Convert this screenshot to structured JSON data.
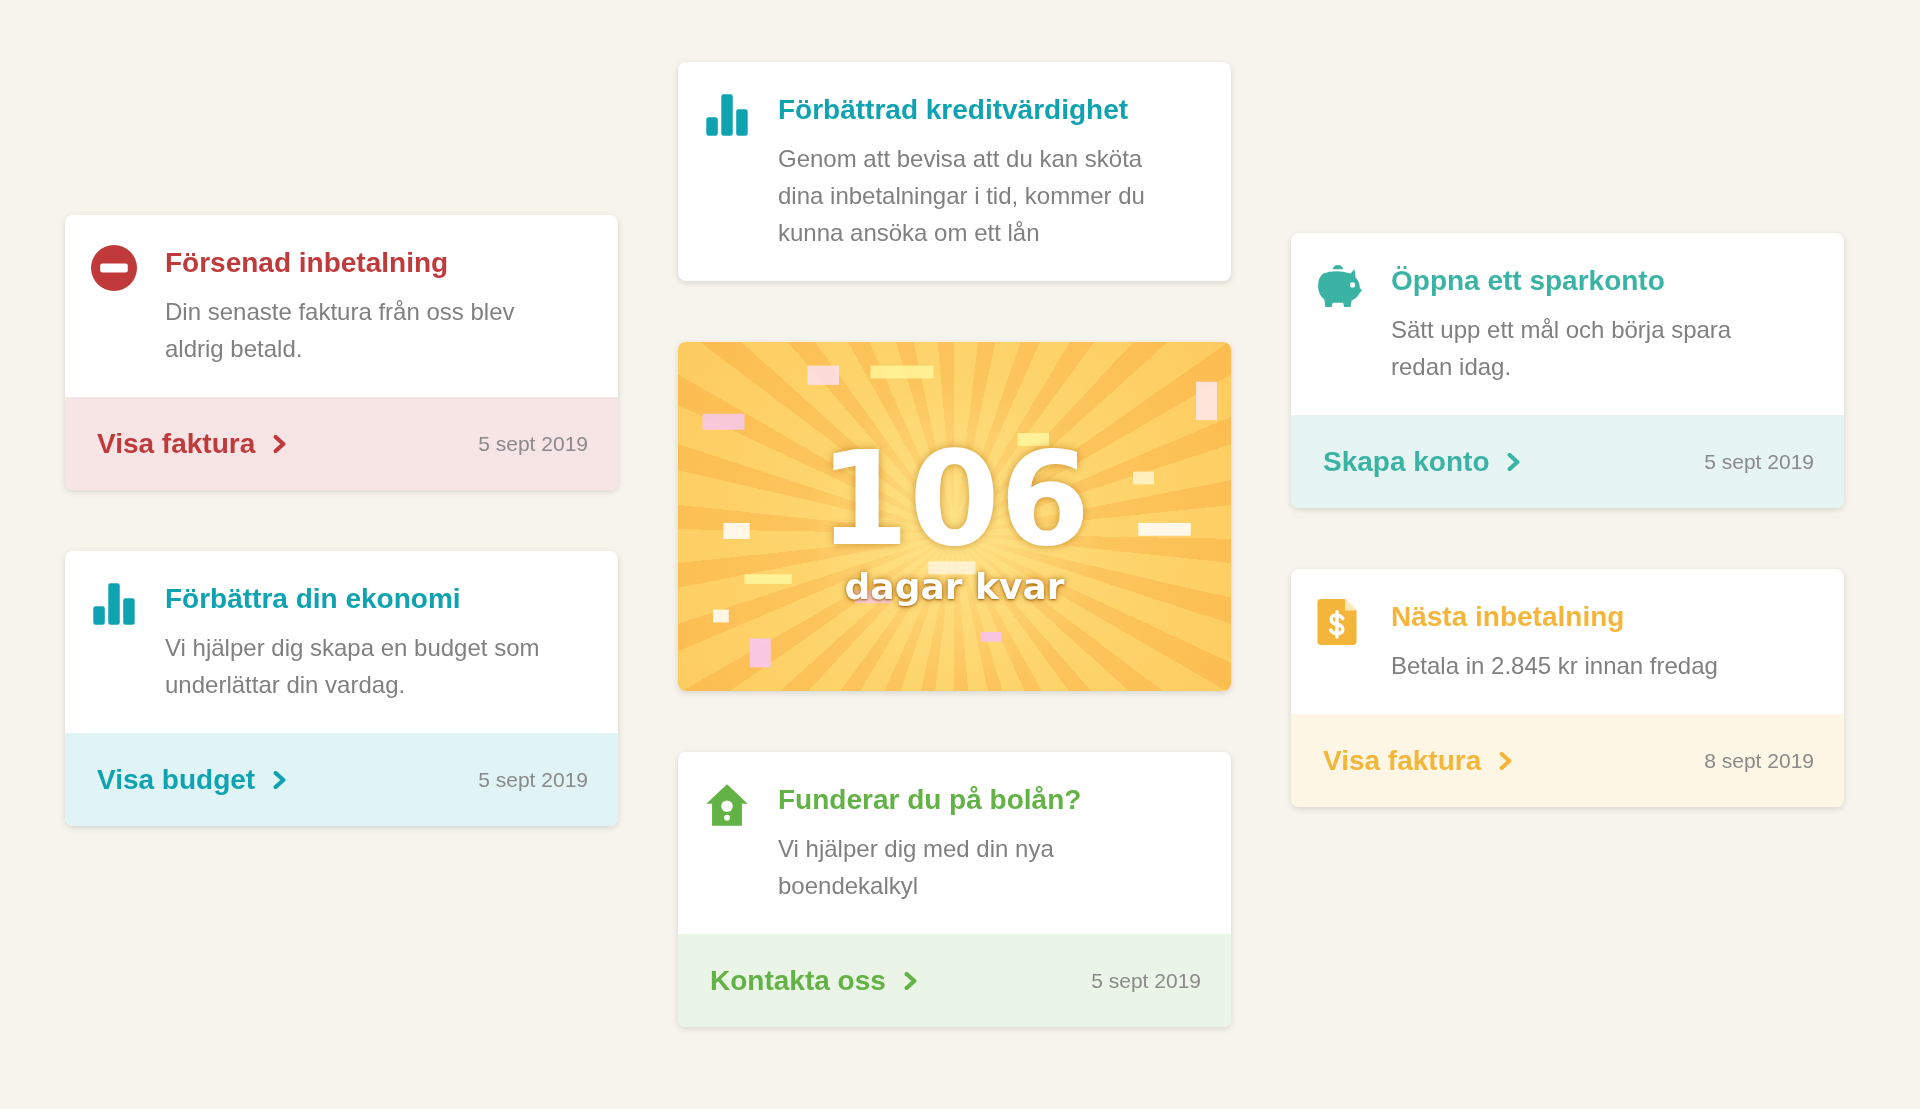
{
  "columns": [
    {
      "cards": [
        {
          "kind": "overdue",
          "color": "#c0393b",
          "title": "Försenad inbetalning",
          "text": "Din senaste faktura från oss blev aldrig betald.",
          "link": "Visa faktura",
          "date": "5 sept 2019"
        },
        {
          "kind": "insight",
          "color": "#0fa3b1",
          "title": "Förbättra din ekonomi",
          "text": "Vi hjälper dig skapa en budget som underlättar din vardag.",
          "link": "Visa budget",
          "date": "5 sept 2019"
        }
      ]
    },
    {
      "cards": [
        {
          "kind": "insight",
          "color": "#0fa3b1",
          "title": "Förbättrad kreditvärdighet",
          "text": "Genom att bevisa att du kan sköta dina inbetalningar i tid, kommer du kunna ansöka om ett lån"
        },
        {
          "kind": "countdown",
          "number": "106",
          "caption": "dagar kvar"
        },
        {
          "kind": "mortgage",
          "color": "#62b246",
          "title": "Funderar du på bolån?",
          "text": "Vi hjälper dig med din nya boendekalkyl",
          "link": "Kontakta oss",
          "date": "5 sept 2019"
        }
      ]
    },
    {
      "cards": [
        {
          "kind": "savings",
          "color": "#3bb3a4",
          "title": "Öppna ett sparkonto",
          "text": "Sätt upp ett mål och börja spara redan idag.",
          "link": "Skapa konto",
          "date": "5 sept 2019"
        },
        {
          "kind": "payment",
          "color": "#f4b63a",
          "title": "Nästa inbetalning",
          "text": "Betala in 2.845 kr innan fredag",
          "link": "Visa faktura",
          "date": "8 sept 2019"
        }
      ]
    }
  ]
}
